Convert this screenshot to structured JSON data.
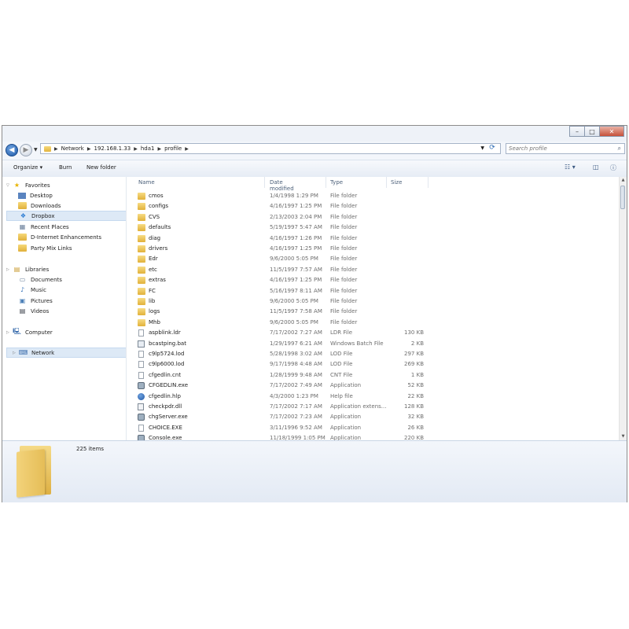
{
  "window": {
    "controls": {
      "minimize": "–",
      "maximize": "□",
      "close": "✕"
    }
  },
  "navigation": {
    "back_icon": "◀",
    "forward_icon": "▶",
    "breadcrumbs": [
      "Network",
      "192.168.1.33",
      "hda1",
      "profile"
    ],
    "search_placeholder": "Search profile"
  },
  "toolbar": {
    "organize_label": "Organize ▾",
    "burn_label": "Burn",
    "new_folder_label": "New folder"
  },
  "sidebar": {
    "favorites_label": "Favorites",
    "favorites": [
      "Desktop",
      "Downloads",
      "Dropbox",
      "Recent Places",
      "D-Internet Enhancements",
      "Party Mix Links"
    ],
    "libraries_label": "Libraries",
    "libraries": [
      "Documents",
      "Music",
      "Pictures",
      "Videos"
    ],
    "computer_label": "Computer",
    "network_label": "Network"
  },
  "columns": {
    "name": "Name",
    "date": "Date modified",
    "type": "Type",
    "size": "Size"
  },
  "files": [
    {
      "name": "cmos",
      "date": "1/4/1998 1:29 PM",
      "type": "File folder",
      "size": "",
      "icon": "folder"
    },
    {
      "name": "configs",
      "date": "4/16/1997 1:25 PM",
      "type": "File folder",
      "size": "",
      "icon": "folder"
    },
    {
      "name": "CVS",
      "date": "2/13/2003 2:04 PM",
      "type": "File folder",
      "size": "",
      "icon": "folder"
    },
    {
      "name": "defaults",
      "date": "5/19/1997 5:47 AM",
      "type": "File folder",
      "size": "",
      "icon": "folder"
    },
    {
      "name": "diag",
      "date": "4/16/1997 1:26 PM",
      "type": "File folder",
      "size": "",
      "icon": "folder"
    },
    {
      "name": "drivers",
      "date": "4/16/1997 1:25 PM",
      "type": "File folder",
      "size": "",
      "icon": "folder"
    },
    {
      "name": "Edr",
      "date": "9/6/2000 5:05 PM",
      "type": "File folder",
      "size": "",
      "icon": "folder"
    },
    {
      "name": "etc",
      "date": "11/5/1997 7:57 AM",
      "type": "File folder",
      "size": "",
      "icon": "folder"
    },
    {
      "name": "extras",
      "date": "4/16/1997 1:25 PM",
      "type": "File folder",
      "size": "",
      "icon": "folder"
    },
    {
      "name": "FC",
      "date": "5/16/1997 8:11 AM",
      "type": "File folder",
      "size": "",
      "icon": "folder"
    },
    {
      "name": "lib",
      "date": "9/6/2000 5:05 PM",
      "type": "File folder",
      "size": "",
      "icon": "folder"
    },
    {
      "name": "logs",
      "date": "11/5/1997 7:58 AM",
      "type": "File folder",
      "size": "",
      "icon": "folder"
    },
    {
      "name": "Mhb",
      "date": "9/6/2000 5:05 PM",
      "type": "File folder",
      "size": "",
      "icon": "folder"
    },
    {
      "name": "aspblink.ldr",
      "date": "7/17/2002 7:27 AM",
      "type": "LDR File",
      "size": "130 KB",
      "icon": "file"
    },
    {
      "name": "bcastping.bat",
      "date": "1/29/1997 6:21 AM",
      "type": "Windows Batch File",
      "size": "2 KB",
      "icon": "bat"
    },
    {
      "name": "c9lp5724.lod",
      "date": "5/28/1998 3:02 AM",
      "type": "LOD File",
      "size": "297 KB",
      "icon": "file"
    },
    {
      "name": "c9lp6000.lod",
      "date": "9/17/1998 4:48 AM",
      "type": "LOD File",
      "size": "269 KB",
      "icon": "file"
    },
    {
      "name": "cfgedlin.cnt",
      "date": "1/28/1999 9:48 AM",
      "type": "CNT File",
      "size": "1 KB",
      "icon": "file"
    },
    {
      "name": "CFGEDLIN.exe",
      "date": "7/17/2002 7:49 AM",
      "type": "Application",
      "size": "52 KB",
      "icon": "exe"
    },
    {
      "name": "cfgedlin.hlp",
      "date": "4/3/2000 1:23 PM",
      "type": "Help file",
      "size": "22 KB",
      "icon": "help"
    },
    {
      "name": "checkpdr.dll",
      "date": "7/17/2002 7:17 AM",
      "type": "Application extens...",
      "size": "128 KB",
      "icon": "dll"
    },
    {
      "name": "chgServer.exe",
      "date": "7/17/2002 7:23 AM",
      "type": "Application",
      "size": "32 KB",
      "icon": "exe"
    },
    {
      "name": "CHOICE.EXE",
      "date": "3/11/1996 9:52 AM",
      "type": "Application",
      "size": "26 KB",
      "icon": "file"
    },
    {
      "name": "Console.exe",
      "date": "11/18/1999 1:05 PM",
      "type": "Application",
      "size": "220 KB",
      "icon": "exe"
    }
  ],
  "details": {
    "item_count": "225 items"
  }
}
